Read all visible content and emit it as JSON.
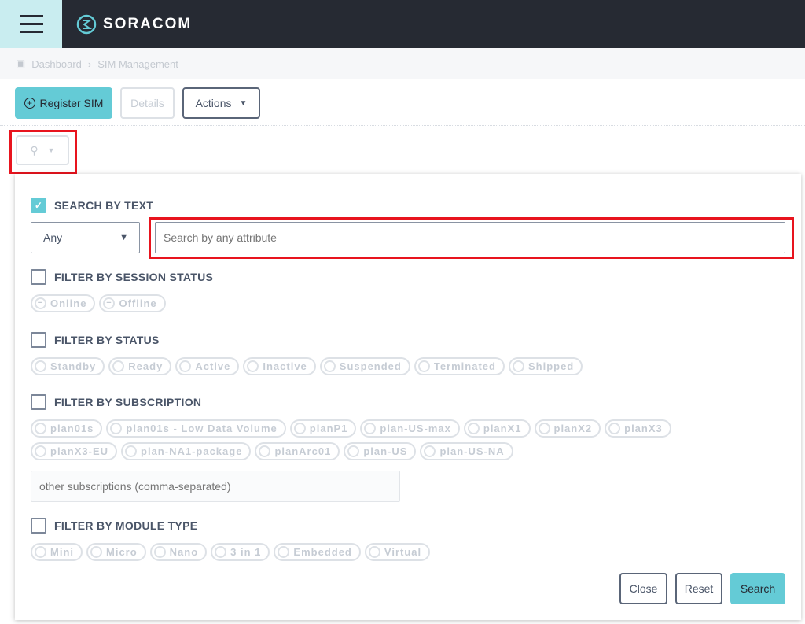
{
  "header": {
    "brand": "SORACOM"
  },
  "breadcrumb": {
    "items": [
      "Dashboard",
      "SIM Management"
    ]
  },
  "toolbar": {
    "register": "Register SIM",
    "details": "Details",
    "actions": "Actions"
  },
  "panel": {
    "search_text": {
      "label": "SEARCH BY TEXT",
      "checked": true,
      "select_value": "Any",
      "placeholder": "Search by any attribute"
    },
    "session": {
      "label": "FILTER BY SESSION STATUS",
      "options": [
        "Online",
        "Offline"
      ]
    },
    "status": {
      "label": "FILTER BY STATUS",
      "options": [
        "Standby",
        "Ready",
        "Active",
        "Inactive",
        "Suspended",
        "Terminated",
        "Shipped"
      ]
    },
    "subscription": {
      "label": "FILTER BY SUBSCRIPTION",
      "options": [
        "plan01s",
        "plan01s - Low Data Volume",
        "planP1",
        "plan-US-max",
        "planX1",
        "planX2",
        "planX3",
        "planX3-EU",
        "plan-NA1-package",
        "planArc01",
        "plan-US",
        "plan-US-NA"
      ],
      "other_placeholder": "other subscriptions (comma-separated)"
    },
    "module": {
      "label": "FILTER BY MODULE TYPE",
      "options": [
        "Mini",
        "Micro",
        "Nano",
        "3 in 1",
        "Embedded",
        "Virtual"
      ]
    },
    "buttons": {
      "close": "Close",
      "reset": "Reset",
      "search": "Search"
    }
  },
  "colors": {
    "accent": "#64cbd6",
    "topbar": "#262a33",
    "highlight": "#e8141e"
  }
}
